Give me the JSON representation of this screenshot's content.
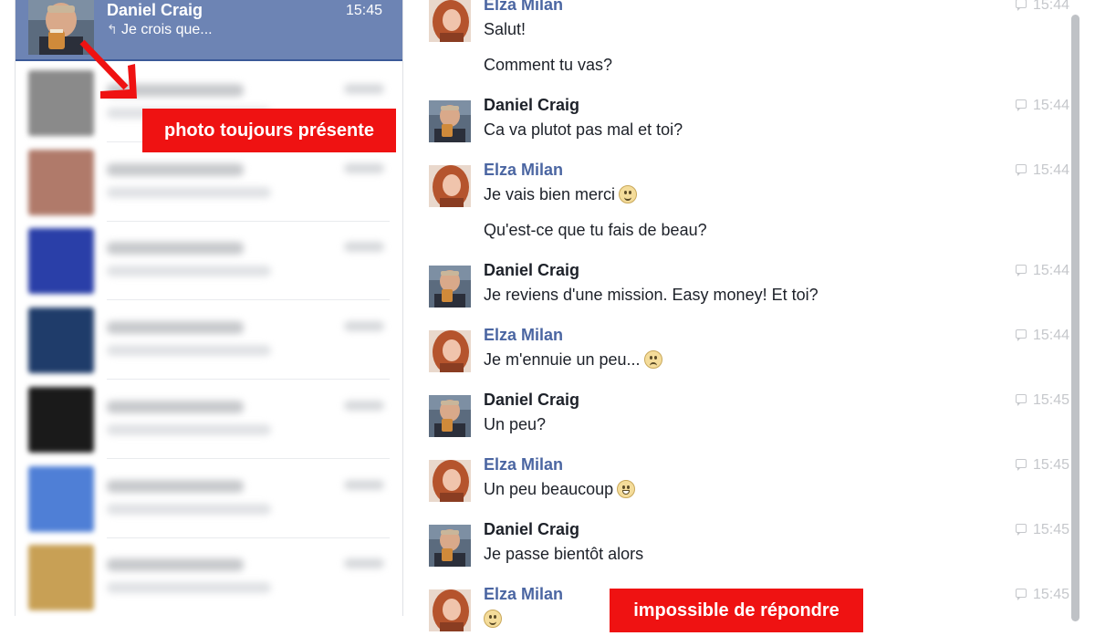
{
  "sidebar": {
    "active_conversation": {
      "name": "Daniel Craig",
      "time": "15:45",
      "snippet": "Je crois que...",
      "reply_icon": "reply-arrow-icon"
    },
    "blurred_conversations": [
      {
        "avatar_color": "#8a8a8a"
      },
      {
        "avatar_color": "#b07a6a"
      },
      {
        "avatar_color": "#2a3fa8"
      },
      {
        "avatar_color": "#1f3c6a"
      },
      {
        "avatar_color": "#1a1a1a"
      },
      {
        "avatar_color": "#4f7fd6"
      },
      {
        "avatar_color": "#c8a055"
      }
    ]
  },
  "annotations": {
    "photo_label": "photo toujours présente",
    "reply_label": "impossible de répondre"
  },
  "messages": [
    {
      "sender": "Elza Milan",
      "side": "elza",
      "time": "15:44",
      "lines": [
        "Salut!",
        "Comment tu vas?"
      ]
    },
    {
      "sender": "Daniel Craig",
      "side": "daniel",
      "time": "15:44",
      "lines": [
        "Ca va plutot pas mal et toi?"
      ]
    },
    {
      "sender": "Elza Milan",
      "side": "elza",
      "time": "15:44",
      "lines": [
        "Je vais bien merci",
        "Qu'est-ce que tu fais de beau?"
      ],
      "emoji_after_first": "smile"
    },
    {
      "sender": "Daniel Craig",
      "side": "daniel",
      "time": "15:44",
      "lines": [
        "Je reviens d'une mission. Easy money! Et toi?"
      ]
    },
    {
      "sender": "Elza Milan",
      "side": "elza",
      "time": "15:44",
      "lines": [
        "Je m'ennuie un peu..."
      ],
      "emoji_after_first": "frown"
    },
    {
      "sender": "Daniel Craig",
      "side": "daniel",
      "time": "15:45",
      "lines": [
        "Un peu?"
      ]
    },
    {
      "sender": "Elza Milan",
      "side": "elza",
      "time": "15:45",
      "lines": [
        "Un peu beaucoup"
      ],
      "emoji_after_first": "grin"
    },
    {
      "sender": "Daniel Craig",
      "side": "daniel",
      "time": "15:45",
      "lines": [
        "Je passe bientôt alors"
      ]
    },
    {
      "sender": "Elza Milan",
      "side": "elza",
      "time": "15:45",
      "lines": [
        ""
      ],
      "emoji_after_first": "smile"
    }
  ],
  "colors": {
    "active_bg": "#6d84b4",
    "elza_name": "#4b66a2",
    "annotation_bg": "#ef1212"
  }
}
